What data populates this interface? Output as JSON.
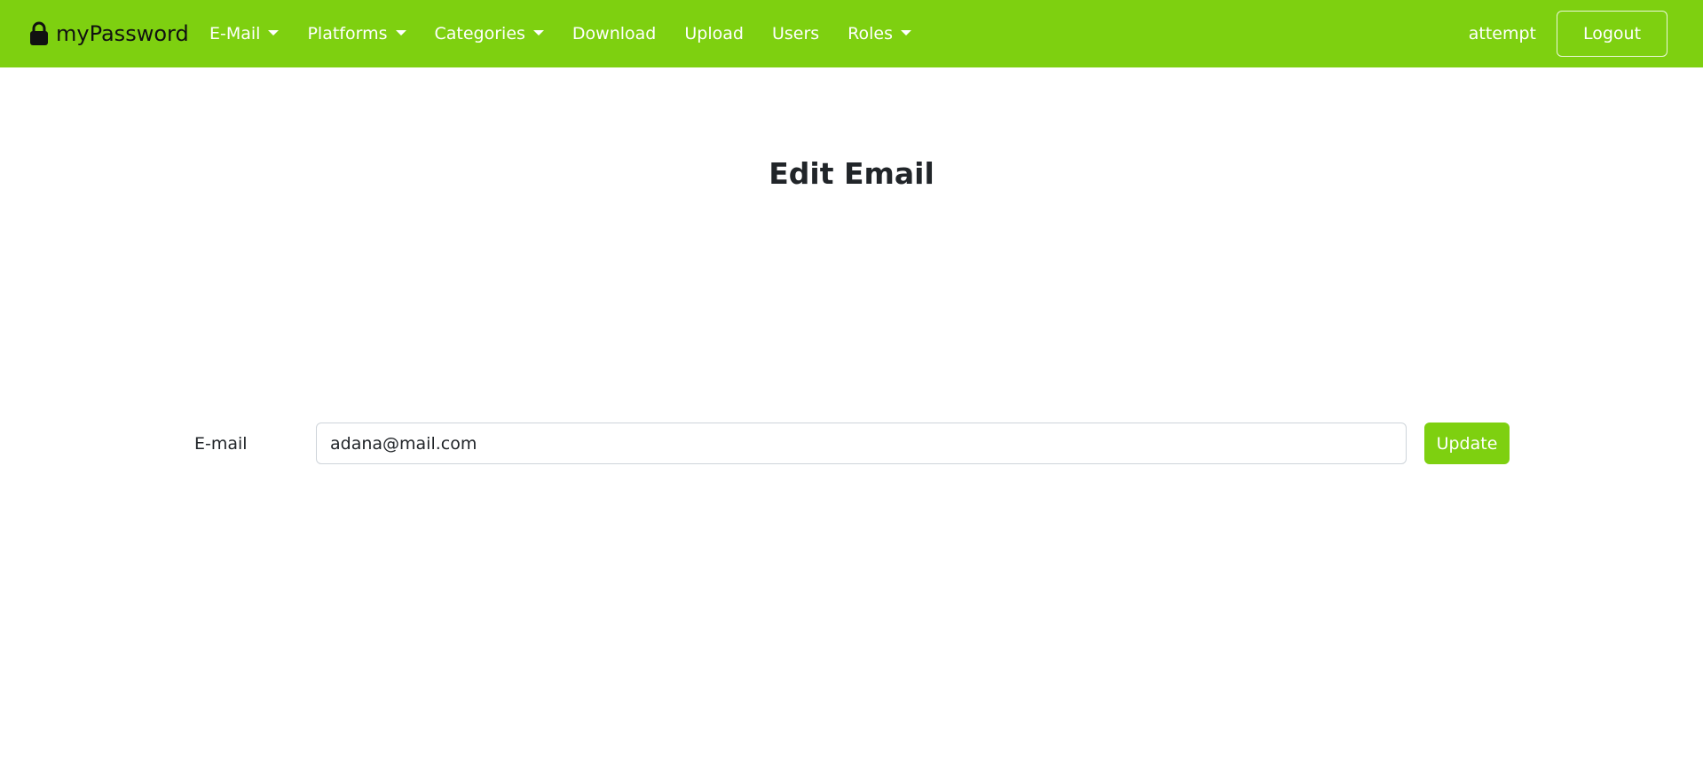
{
  "navbar": {
    "brand_label": "myPassword",
    "brand_icon": "lock-icon",
    "items": [
      {
        "label": "E-Mail",
        "dropdown": true
      },
      {
        "label": "Platforms",
        "dropdown": true
      },
      {
        "label": "Categories",
        "dropdown": true
      },
      {
        "label": "Download",
        "dropdown": false
      },
      {
        "label": "Upload",
        "dropdown": false
      },
      {
        "label": "Users",
        "dropdown": false
      },
      {
        "label": "Roles",
        "dropdown": true
      }
    ],
    "username": "attempt",
    "logout_label": "Logout"
  },
  "page": {
    "title": "Edit Email"
  },
  "form": {
    "email_label": "E-mail",
    "email_value": "adana@mail.com",
    "update_label": "Update"
  },
  "colors": {
    "accent": "#7ed010",
    "text": "#212529"
  }
}
